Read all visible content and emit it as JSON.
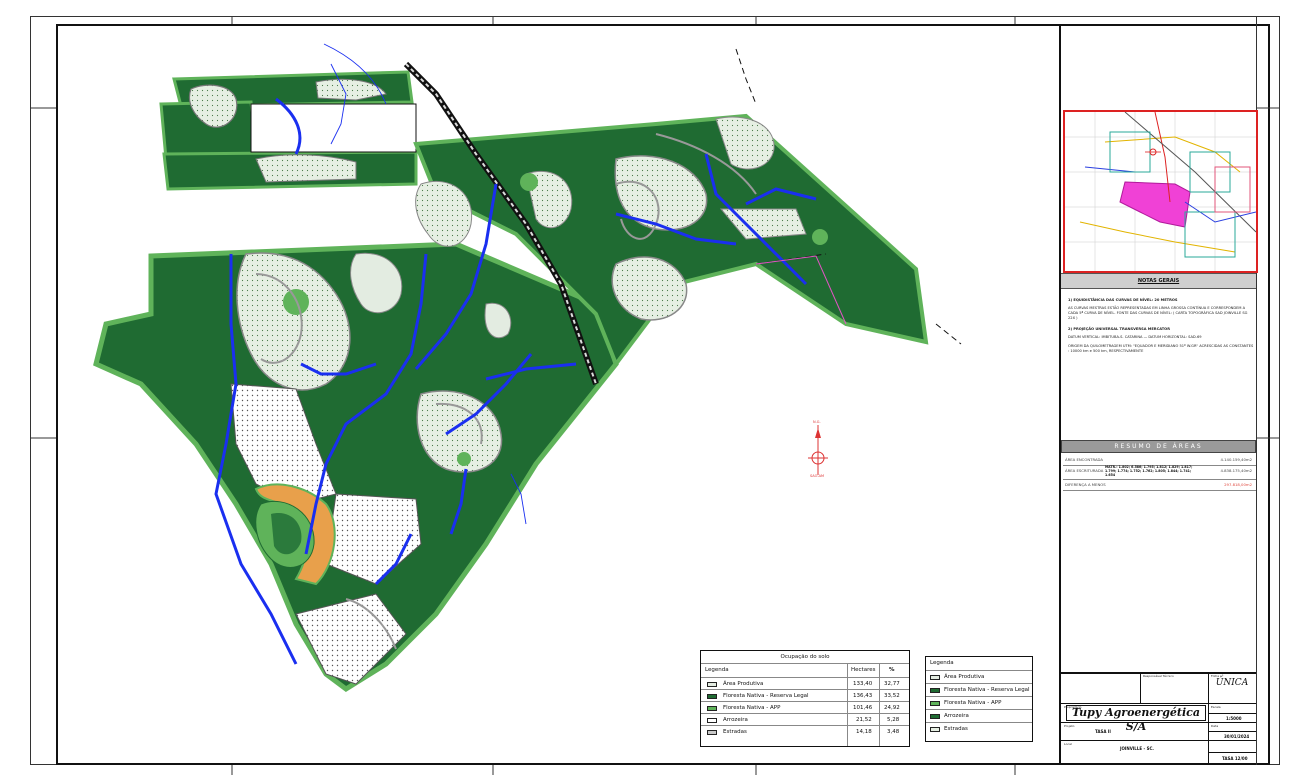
{
  "colors": {
    "floresta_reserva": "#1f6b32",
    "floresta_app": "#5fb35a",
    "area_produtiva": "#e3ece1",
    "arrozeira": "#ffffff",
    "estradas": "#c8c8c8",
    "rio": "#1a2ff0",
    "red": "#e0483e"
  },
  "north": {
    "top": "N.G.",
    "bottom": "SAO-AM"
  },
  "notes": {
    "title": "NOTAS GERAIS",
    "items": [
      {
        "heading": "1) EQUIDISTÂNCIA DAS CURVAS DE NÍVEL: 20 METROS",
        "text": "AS CURVAS MESTRAS ESTÃO REPRESENTADAS EM LINHA GROSSA CONTÍNUA E CORRESPONDEM A CADA 5ª CURVA DE NÍVEL. FONTE DAS CURVAS DE NÍVEL: ( CARTA TOPOGRÁFICA SAD JOINVILLE SG 22X )"
      },
      {
        "heading": "2) PROJEÇÃO UNIVERSAL TRANSVERSA MERCATOR",
        "text": "DATUM VERTICAL: IMBITUBA-S. CATARINA — DATUM HORIZONTAL: SAD-69"
      },
      {
        "heading": "",
        "text": "ORIGEM DA QUILOMETRAGEM UTM: \"EQUADOR E MERIDIANO 51º W.GR\" ACRESCIDAS AS CONSTANTES : 10000 km e 500 km, RESPECTIVAMENTE"
      }
    ]
  },
  "areas": {
    "title": "RESUMO DE ÁREAS",
    "rows": [
      {
        "label": "ÁREA ENCONTRADA",
        "detail": "",
        "value": "4.140.159,40m2"
      },
      {
        "label": "ÁREA ESCRITURADA",
        "detail": "MATR.: 1.802; 6.586; 1.795; 1.812; 1.829; 1.817; 1.799; 1.774; 1.752; 1.762; 1.805; 1.844; 1.741; 1.654",
        "value": "4.838.175,40m2"
      },
      {
        "label": "DIFERENÇA A MENOS",
        "detail": "",
        "value": "297.818,00m2"
      }
    ]
  },
  "title_block": {
    "unica": "ÚNICA",
    "company": "Tupy Agroenergética S/A",
    "project_label": "Projeto",
    "project": "TASA II",
    "place_label": "Local",
    "place": "JOINVILLE - SC.",
    "sheet_label": "Folha nº",
    "date_label": "Data",
    "date": "30/01/2024",
    "scale_label": "Escala",
    "scale": "1:5000",
    "number": "TASA 12/00",
    "owner_label": "Proprietário",
    "resp_label": "Responsável Técnico"
  },
  "ocupacao": {
    "title": "Ocupação do solo",
    "headers": [
      "Legenda",
      "Hectares",
      "%"
    ],
    "rows": [
      {
        "name": "Área Produtiva",
        "ha": "133,40",
        "pct": "32,77",
        "swatch": "area_produtiva"
      },
      {
        "name": "Floresta Nativa - Reserva Legal",
        "ha": "136,43",
        "pct": "33,52",
        "swatch": "floresta_reserva"
      },
      {
        "name": "Floresta Nativa - APP",
        "ha": "101,46",
        "pct": "24,92",
        "swatch": "floresta_app"
      },
      {
        "name": "Arrozeira",
        "ha": "21,52",
        "pct": "5,28",
        "swatch": "arrozeira"
      },
      {
        "name": "Estradas",
        "ha": "14,18",
        "pct": "3,48",
        "swatch": "estradas"
      }
    ]
  },
  "legenda": {
    "title": "Legenda",
    "rows": [
      {
        "name": "Área Produtiva",
        "swatch": "area_produtiva"
      },
      {
        "name": "Floresta Nativa - Reserva Legal",
        "swatch": "floresta_reserva"
      },
      {
        "name": "Floresta Nativa - APP",
        "swatch": "floresta_app"
      },
      {
        "name": "Arrozeira",
        "swatch": "arrozeira"
      },
      {
        "name": "Estradas",
        "swatch": "estradas"
      }
    ]
  }
}
